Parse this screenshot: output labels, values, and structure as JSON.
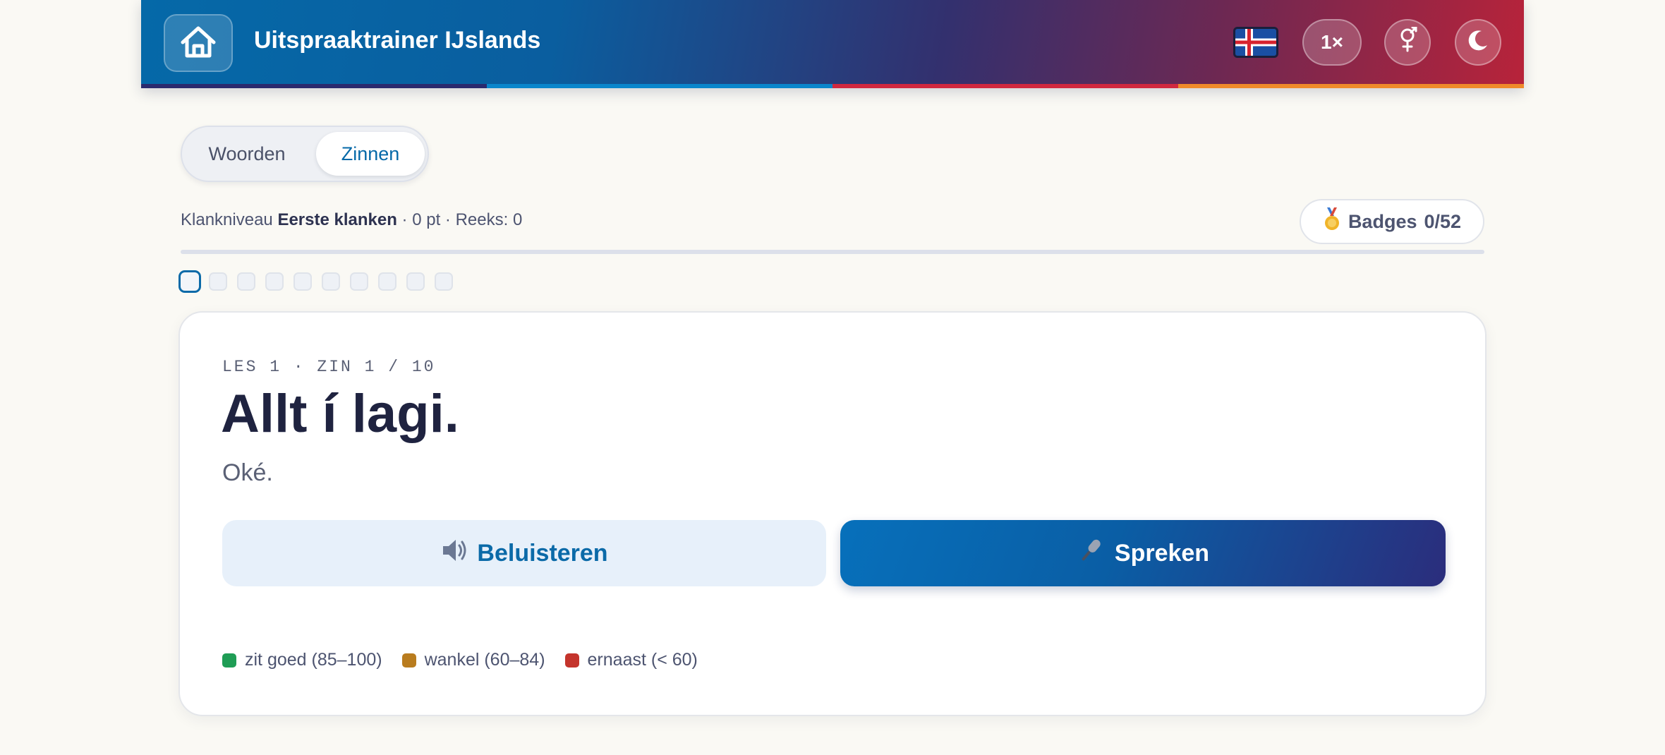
{
  "header": {
    "title": "Uitspraaktrainer IJslands",
    "home_icon": "home-icon",
    "flag_icon": "iceland-flag-icon",
    "speed_label": "1×",
    "gender_icon": "gender-icon",
    "theme_icon": "moon-icon",
    "stripe_colors": [
      "#2b2a6e",
      "#0a86cc",
      "#d1283f",
      "#ef8a2a"
    ]
  },
  "mode_tabs": [
    {
      "label": "Woorden",
      "selected": false
    },
    {
      "label": "Zinnen",
      "selected": true
    }
  ],
  "status": {
    "prefix": "Klankniveau",
    "level": "Eerste klanken",
    "points": "· 0 pt",
    "streak": "· Reeks: 0"
  },
  "badges": {
    "icon": "medal-icon",
    "label": "Badges",
    "count": "0/52"
  },
  "progress": {
    "current_index": 0,
    "total": 10
  },
  "card": {
    "eyebrow": "LES 1 · ZIN 1 / 10",
    "phrase": "Allt í lagi.",
    "translation": "Oké.",
    "listen_icon": "speaker-icon",
    "listen_label": "Beluisteren",
    "speak_icon": "microphone-icon",
    "speak_label": "Spreken"
  },
  "legend": [
    {
      "label": "zit goed (85–100)",
      "color": "#1f9d55"
    },
    {
      "label": "wankel (60–84)",
      "color": "#b97c1e"
    },
    {
      "label": "ernaast (< 60)",
      "color": "#c4342c"
    }
  ],
  "colors": {
    "accent": "#0569a8",
    "header_gradient_start": "#0569a8",
    "header_gradient_end": "#b8233a"
  }
}
